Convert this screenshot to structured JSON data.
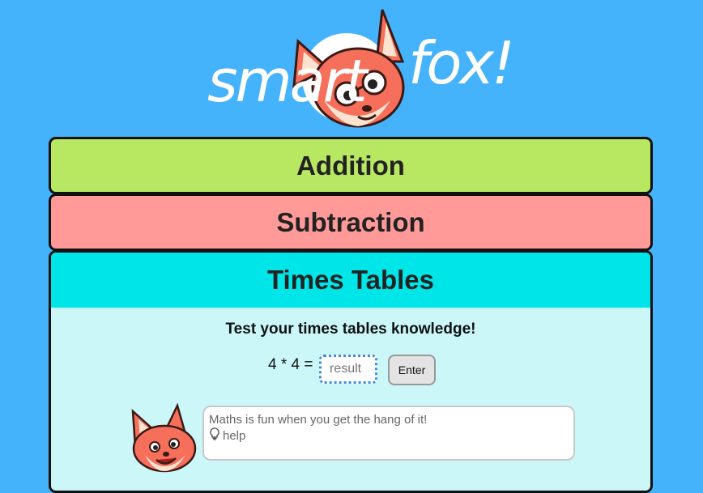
{
  "logo": {
    "word_left": "smart",
    "word_right": "fox!"
  },
  "sections": {
    "addition": "Addition",
    "subtraction": "Subtraction",
    "times_tables": "Times Tables"
  },
  "times_tables": {
    "prompt": "Test your times tables knowledge!",
    "question": "4 * 4 =",
    "result_placeholder": "result",
    "enter_label": "Enter"
  },
  "tip": {
    "message": "Maths is fun when you get the hang of it!",
    "help_label": "help",
    "help_icon": "lightbulb-icon"
  },
  "colors": {
    "background": "#45b2fc",
    "addition": "#b8e862",
    "subtraction": "#ff9a99",
    "times_tables_header": "#00e6e8",
    "times_tables_body": "#cbf7f9"
  }
}
